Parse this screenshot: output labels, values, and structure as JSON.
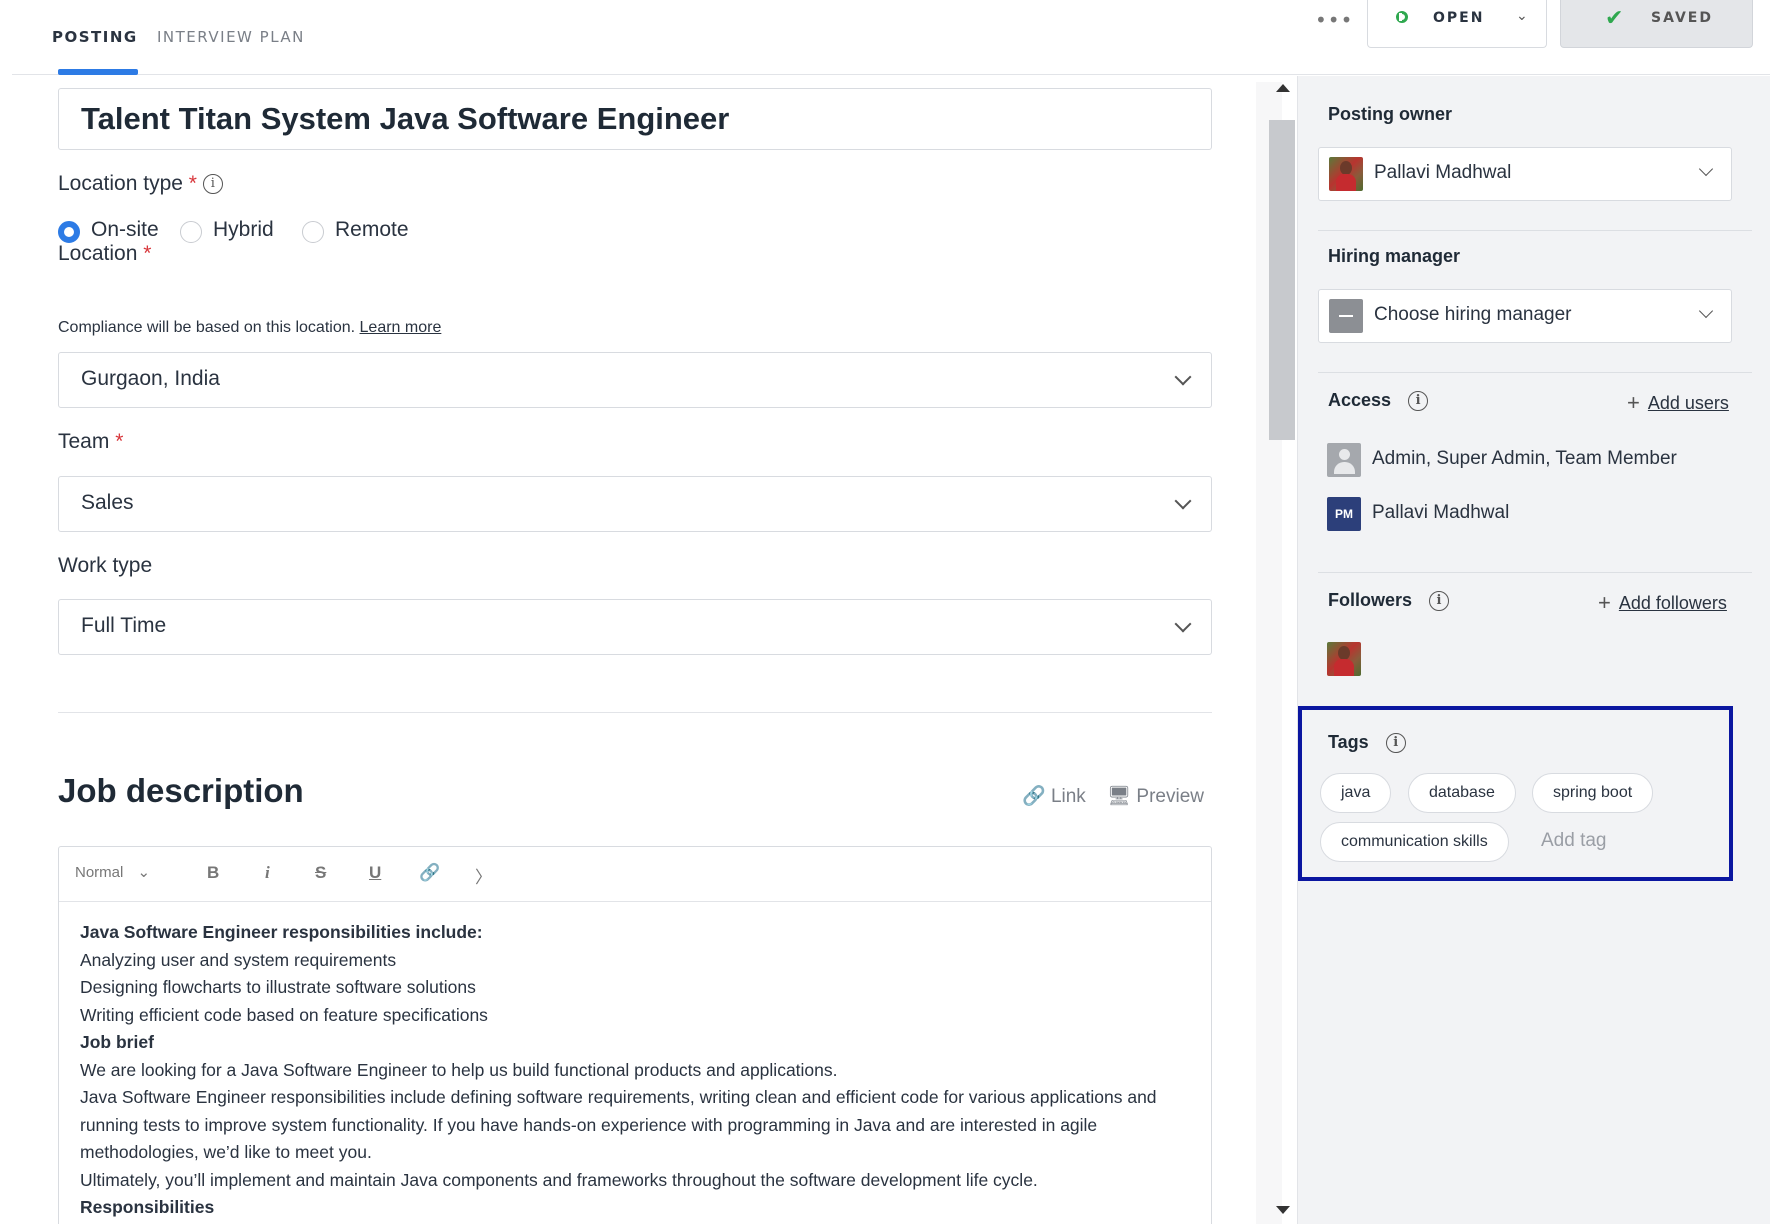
{
  "tabs": [
    {
      "label": "POSTING",
      "active": true
    },
    {
      "label": "INTERVIEW PLAN",
      "active": false
    }
  ],
  "header": {
    "more_label": "•••",
    "status_label": "OPEN",
    "saved_label": "SAVED"
  },
  "form": {
    "title": "Talent Titan System Java Software Engineer",
    "location_type": {
      "label": "Location type",
      "options": [
        "On-site",
        "Hybrid",
        "Remote"
      ],
      "selected": "On-site"
    },
    "location": {
      "label": "Location",
      "hint": "Compliance will be based on this location.",
      "hint_link": "Learn more",
      "value": "Gurgaon, India"
    },
    "team": {
      "label": "Team",
      "value": "Sales"
    },
    "work_type": {
      "label": "Work type",
      "value": "Full Time"
    }
  },
  "job_description": {
    "title": "Job description",
    "link_label": "Link",
    "preview_label": "Preview",
    "toolbar": {
      "format": "Normal"
    },
    "lines": [
      {
        "text": "Java Software Engineer responsibilities include:",
        "bold": true
      },
      {
        "text": "Analyzing user and system requirements",
        "bold": false
      },
      {
        "text": "Designing flowcharts to illustrate software solutions",
        "bold": false
      },
      {
        "text": "Writing efficient code based on feature specifications",
        "bold": false
      },
      {
        "text": "Job brief",
        "bold": true
      },
      {
        "text": "We are looking for a Java Software Engineer to help us build functional products and applications.",
        "bold": false
      },
      {
        "text": "Java Software Engineer responsibilities include defining software requirements, writing clean and efficient code for various applications and running tests to improve system functionality. If you have hands-on experience with programming in Java and are interested in agile methodologies, we’d like to meet you.",
        "bold": false
      },
      {
        "text": "Ultimately, you’ll implement and maintain Java components and frameworks throughout the software development life cycle.",
        "bold": false
      },
      {
        "text": "Responsibilities",
        "bold": true
      }
    ]
  },
  "sidebar": {
    "posting_owner": {
      "label": "Posting owner",
      "value": "Pallavi Madhwal"
    },
    "hiring_manager": {
      "label": "Hiring manager",
      "placeholder": "Choose hiring manager"
    },
    "access": {
      "label": "Access",
      "add_label": "Add users",
      "entries": [
        {
          "name": "Admin, Super Admin, Team Member",
          "avatar": "group"
        },
        {
          "name": "Pallavi Madhwal",
          "avatar_initials": "PM"
        }
      ]
    },
    "followers": {
      "label": "Followers",
      "add_label": "Add followers"
    },
    "tags": {
      "label": "Tags",
      "items": [
        "java",
        "database",
        "spring boot",
        "communication skills"
      ],
      "add_placeholder": "Add tag"
    }
  },
  "colors": {
    "accent": "#2d7be5",
    "status_open": "#2fa84f",
    "required": "#d8363b",
    "highlight_box": "#0b16a0"
  }
}
